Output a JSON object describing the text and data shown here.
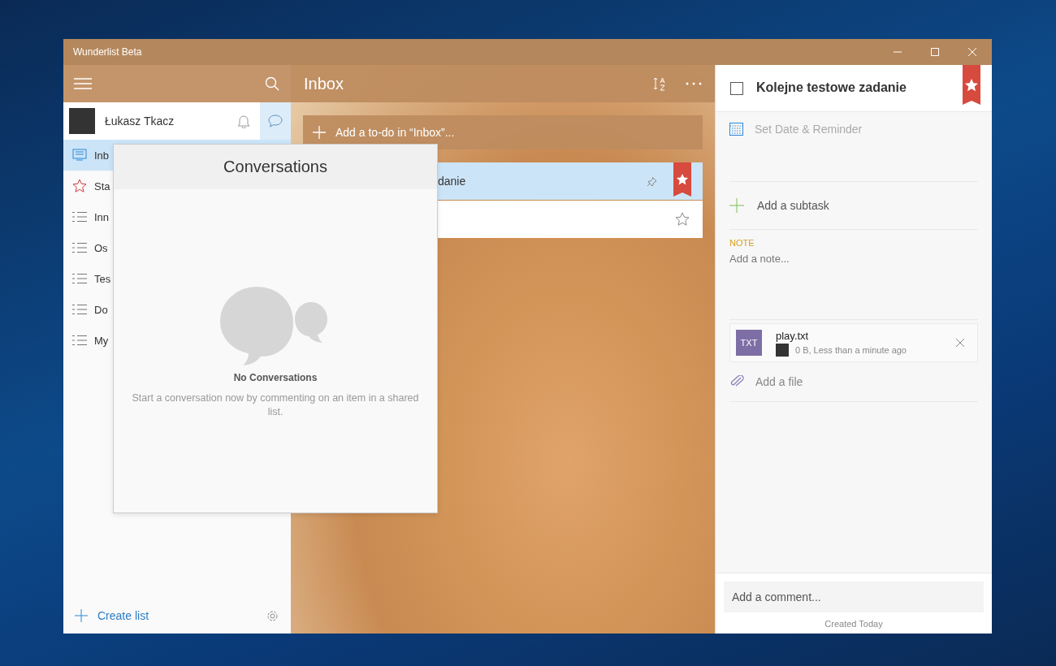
{
  "window": {
    "title": "Wunderlist Beta"
  },
  "sidebar": {
    "user": {
      "name": "Łukasz Tkacz"
    },
    "items": [
      {
        "kind": "inbox",
        "label": "Inb",
        "selected": true
      },
      {
        "kind": "star",
        "label": "Sta",
        "selected": false
      },
      {
        "kind": "list",
        "label": "Inn",
        "selected": false
      },
      {
        "kind": "list",
        "label": "Os",
        "selected": false
      },
      {
        "kind": "list",
        "label": "Tes",
        "selected": false
      },
      {
        "kind": "list",
        "label": "Do",
        "selected": false
      },
      {
        "kind": "list",
        "label": "My",
        "selected": false
      }
    ],
    "create_list": "Create list"
  },
  "conversations": {
    "title": "Conversations",
    "empty_title": "No Conversations",
    "empty_text": "Start a conversation now by commenting on an item in a shared list."
  },
  "list": {
    "title": "Inbox",
    "add_placeholder": "Add a to-do in “Inbox”...",
    "tasks": [
      {
        "title": "danie",
        "selected": true,
        "starred": true
      },
      {
        "selected": false,
        "starred": false
      }
    ]
  },
  "detail": {
    "task": {
      "title": "Kolejne testowe zadanie",
      "checked": false,
      "starred": true
    },
    "reminder": "Set Date & Reminder",
    "subtask_placeholder": "Add a subtask",
    "note_label": "NOTE",
    "note_placeholder": "Add a note...",
    "files": [
      {
        "type": "TXT",
        "name": "play.txt",
        "meta": "0 B, Less than a minute ago"
      }
    ],
    "add_file": "Add a file",
    "comment_placeholder": "Add a comment...",
    "created": "Created Today"
  }
}
